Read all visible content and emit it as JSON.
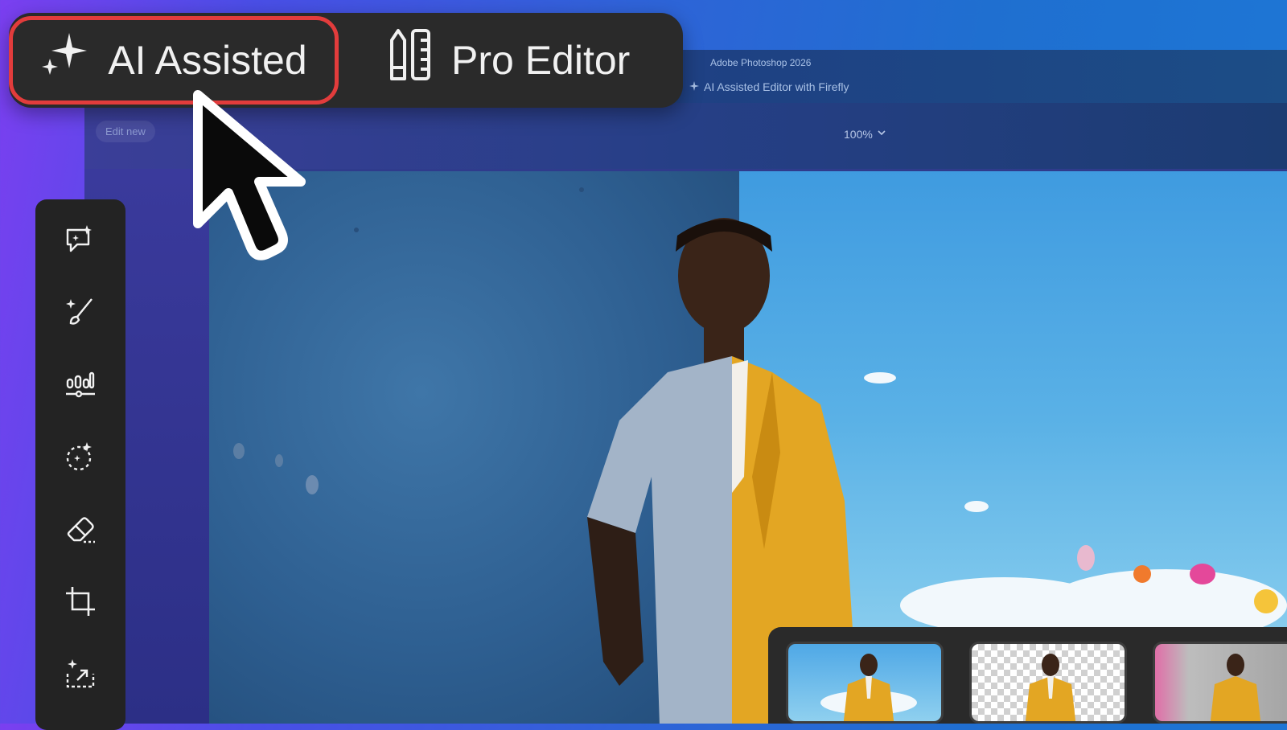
{
  "mode_switcher": {
    "ai_label": "AI Assisted",
    "pro_label": "Pro Editor",
    "selected": "AI Assisted",
    "highlight_color": "#e23c3c"
  },
  "app": {
    "title": "Adobe Photoshop 2026",
    "subtitle": "AI Assisted Editor with Firefly",
    "edit_new_label": "Edit new",
    "zoom_label": "100%"
  },
  "toolbar": {
    "tools": [
      {
        "icon": "chat-sparkle-icon"
      },
      {
        "icon": "brush-sparkle-icon"
      },
      {
        "icon": "adjustments-icon"
      },
      {
        "icon": "selection-sparkle-icon"
      },
      {
        "icon": "eraser-icon"
      },
      {
        "icon": "crop-icon"
      },
      {
        "icon": "expand-sparkle-icon"
      }
    ]
  },
  "thumbnails": [
    {
      "icon": "sky-background-thumbnail"
    },
    {
      "icon": "transparent-background-thumbnail"
    },
    {
      "icon": "studio-background-thumbnail"
    }
  ]
}
